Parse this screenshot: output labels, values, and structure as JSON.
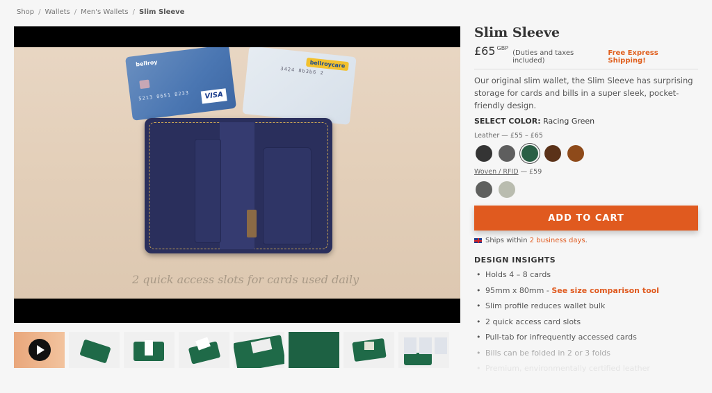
{
  "breadcrumb": {
    "items": [
      "Shop",
      "Wallets",
      "Men's Wallets"
    ],
    "current": "Slim Sleeve",
    "separator": "/"
  },
  "media": {
    "video_caption": "2 quick access slots for cards used daily",
    "card_left_brand": "bellroy",
    "card_left_number": "5213 0651 8233",
    "card_left_logo": "VISA",
    "card_right_brand": "bellroycare",
    "card_right_number": "3424 8b3b6 2",
    "thumbnail_count": 8
  },
  "product": {
    "title": "Slim Sleeve",
    "price": "£65",
    "currency": "GBP",
    "tax_note": "(Duties and taxes included)",
    "shipping_badge": "Free Express Shipping!",
    "description": "Our original slim wallet, the Slim Sleeve has surprising storage for cards and bills in a super sleek, pocket-friendly design.",
    "select_color_label": "SELECT COLOR:",
    "selected_color": "Racing Green",
    "leather_group": "Leather — £55 – £65",
    "woven_group_link": "Woven / RFID",
    "woven_group_price": " — £59",
    "leather_swatches": [
      "#343434",
      "#5e5e5e",
      "#2a5f45",
      "#5b3219",
      "#8e4a1a"
    ],
    "woven_swatches": [
      "#5f605e",
      "#b9bcaf"
    ],
    "add_to_cart": "ADD TO CART",
    "ships_prefix": "Ships within ",
    "ships_highlight": "2 business days",
    "ships_suffix": "."
  },
  "insights": {
    "title": "DESIGN INSIGHTS",
    "items": [
      "Holds 4 – 8 cards",
      "95mm x 80mm - ",
      "Slim profile reduces wallet bulk",
      "2 quick access card slots",
      "Pull-tab for infrequently accessed cards",
      "Bills can be folded in 2 or 3 folds",
      "Premium, environmentally certified leather"
    ],
    "size_link": "See size comparison tool"
  },
  "colors": {
    "accent": "#e05a1f",
    "background": "#f6f6f6"
  }
}
